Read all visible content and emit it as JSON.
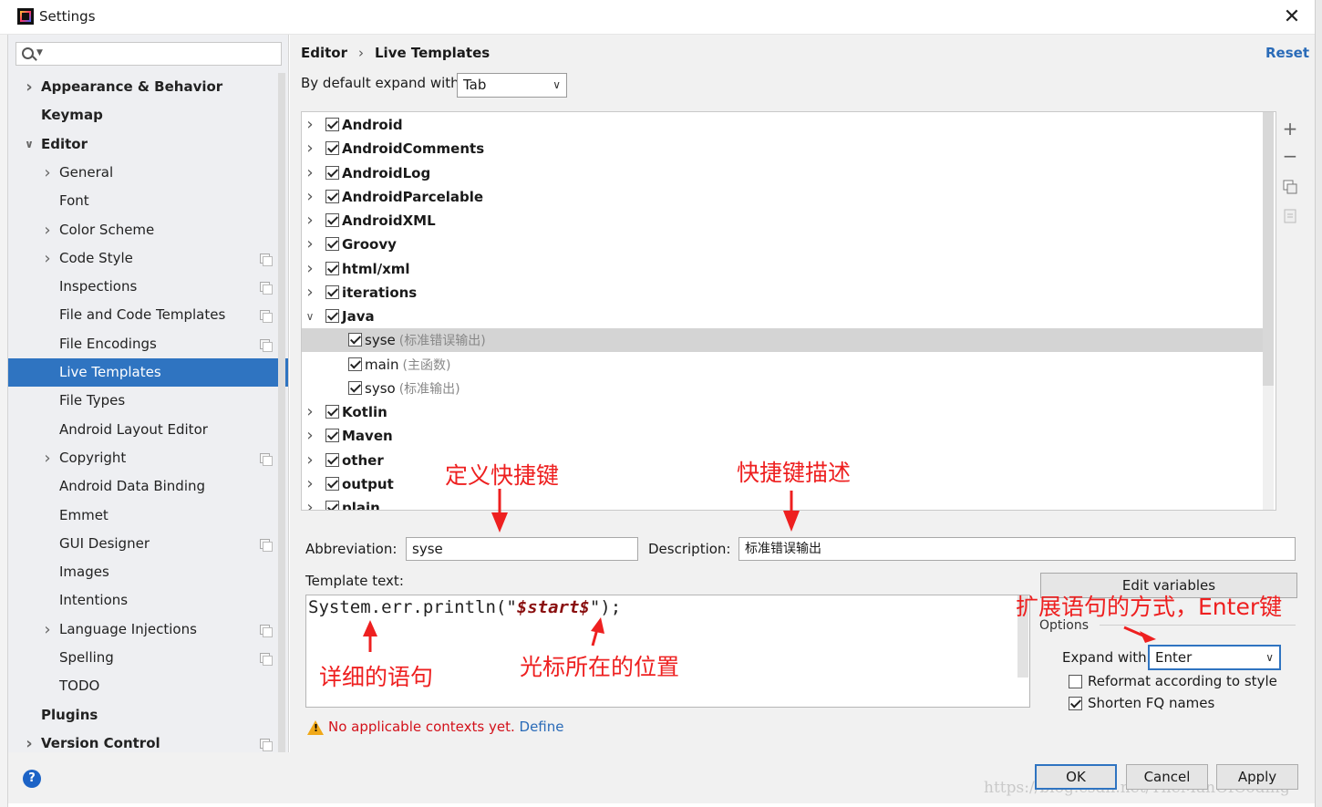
{
  "window": {
    "title": "Settings"
  },
  "search": {
    "placeholder": ""
  },
  "sidebar": {
    "items": [
      {
        "label": "Appearance & Behavior",
        "level": 0,
        "bold": true,
        "arrow": "right",
        "copy": false
      },
      {
        "label": "Keymap",
        "level": 0,
        "bold": true,
        "arrow": "",
        "copy": false
      },
      {
        "label": "Editor",
        "level": 0,
        "bold": true,
        "arrow": "down",
        "copy": false
      },
      {
        "label": "General",
        "level": 1,
        "bold": false,
        "arrow": "right",
        "copy": false
      },
      {
        "label": "Font",
        "level": 1,
        "bold": false,
        "arrow": "",
        "copy": false
      },
      {
        "label": "Color Scheme",
        "level": 1,
        "bold": false,
        "arrow": "right",
        "copy": false
      },
      {
        "label": "Code Style",
        "level": 1,
        "bold": false,
        "arrow": "right",
        "copy": true
      },
      {
        "label": "Inspections",
        "level": 1,
        "bold": false,
        "arrow": "",
        "copy": true
      },
      {
        "label": "File and Code Templates",
        "level": 1,
        "bold": false,
        "arrow": "",
        "copy": true
      },
      {
        "label": "File Encodings",
        "level": 1,
        "bold": false,
        "arrow": "",
        "copy": true
      },
      {
        "label": "Live Templates",
        "level": 1,
        "bold": false,
        "arrow": "",
        "copy": false,
        "selected": true
      },
      {
        "label": "File Types",
        "level": 1,
        "bold": false,
        "arrow": "",
        "copy": false
      },
      {
        "label": "Android Layout Editor",
        "level": 1,
        "bold": false,
        "arrow": "",
        "copy": false
      },
      {
        "label": "Copyright",
        "level": 1,
        "bold": false,
        "arrow": "right",
        "copy": true
      },
      {
        "label": "Android Data Binding",
        "level": 1,
        "bold": false,
        "arrow": "",
        "copy": false
      },
      {
        "label": "Emmet",
        "level": 1,
        "bold": false,
        "arrow": "",
        "copy": false
      },
      {
        "label": "GUI Designer",
        "level": 1,
        "bold": false,
        "arrow": "",
        "copy": true
      },
      {
        "label": "Images",
        "level": 1,
        "bold": false,
        "arrow": "",
        "copy": false
      },
      {
        "label": "Intentions",
        "level": 1,
        "bold": false,
        "arrow": "",
        "copy": false
      },
      {
        "label": "Language Injections",
        "level": 1,
        "bold": false,
        "arrow": "right",
        "copy": true
      },
      {
        "label": "Spelling",
        "level": 1,
        "bold": false,
        "arrow": "",
        "copy": true
      },
      {
        "label": "TODO",
        "level": 1,
        "bold": false,
        "arrow": "",
        "copy": false
      },
      {
        "label": "Plugins",
        "level": 0,
        "bold": true,
        "arrow": "",
        "copy": false
      },
      {
        "label": "Version Control",
        "level": 0,
        "bold": true,
        "arrow": "right",
        "copy": true
      }
    ]
  },
  "breadcrumb": {
    "parent": "Editor",
    "separator": "›",
    "current": "Live Templates"
  },
  "reset_label": "Reset",
  "expand_default": {
    "label": "By default expand with",
    "value": "Tab"
  },
  "templates": [
    {
      "name": "Android",
      "group": true,
      "arrow": "right",
      "checked": true
    },
    {
      "name": "AndroidComments",
      "group": true,
      "arrow": "right",
      "checked": true
    },
    {
      "name": "AndroidLog",
      "group": true,
      "arrow": "right",
      "checked": true
    },
    {
      "name": "AndroidParcelable",
      "group": true,
      "arrow": "right",
      "checked": true
    },
    {
      "name": "AndroidXML",
      "group": true,
      "arrow": "right",
      "checked": true
    },
    {
      "name": "Groovy",
      "group": true,
      "arrow": "right",
      "checked": true
    },
    {
      "name": "html/xml",
      "group": true,
      "arrow": "right",
      "checked": true
    },
    {
      "name": "iterations",
      "group": true,
      "arrow": "right",
      "checked": true
    },
    {
      "name": "Java",
      "group": true,
      "arrow": "down",
      "checked": true
    },
    {
      "name": "syse",
      "desc": "(标准错误输出)",
      "group": false,
      "checked": true,
      "selected": true
    },
    {
      "name": "main",
      "desc": "(主函数)",
      "group": false,
      "checked": true
    },
    {
      "name": "syso",
      "desc": "(标准输出)",
      "group": false,
      "checked": true
    },
    {
      "name": "Kotlin",
      "group": true,
      "arrow": "right",
      "checked": true
    },
    {
      "name": "Maven",
      "group": true,
      "arrow": "right",
      "checked": true
    },
    {
      "name": "other",
      "group": true,
      "arrow": "right",
      "checked": true
    },
    {
      "name": "output",
      "group": true,
      "arrow": "right",
      "checked": true
    },
    {
      "name": "plain",
      "group": true,
      "arrow": "right",
      "checked": true
    }
  ],
  "toolbar": {
    "add": "+",
    "remove": "−"
  },
  "abbreviation": {
    "label": "Abbreviation:",
    "value": "syse"
  },
  "description": {
    "label": "Description:",
    "value": "标准错误输出"
  },
  "template_text": {
    "label": "Template text:",
    "code_before": "System.err.println(\"",
    "code_var": "$start$",
    "code_after": "\");"
  },
  "edit_variables_label": "Edit variables",
  "options": {
    "label": "Options",
    "expand_with_label": "Expand with",
    "expand_with_value": "Enter",
    "reformat_label": "Reformat according to style",
    "reformat_checked": false,
    "shorten_label": "Shorten FQ names",
    "shorten_checked": true
  },
  "warning": {
    "text": "No applicable contexts yet.",
    "link": "Define"
  },
  "buttons": {
    "ok": "OK",
    "cancel": "Cancel",
    "apply": "Apply",
    "help": "?"
  },
  "watermark": "https://blog.csdn.net/TheManOfCoding",
  "annotations": {
    "define_shortcut": "定义快捷键",
    "shortcut_desc": "快捷键描述",
    "expand_way": "扩展语句的方式，Enter键",
    "detail_stmt": "详细的语句",
    "cursor_pos": "光标所在的位置"
  },
  "colors": {
    "selection": "#2f74c1",
    "link": "#2a6bb8",
    "annotation": "#ee2020",
    "warning": "#d3111a"
  }
}
